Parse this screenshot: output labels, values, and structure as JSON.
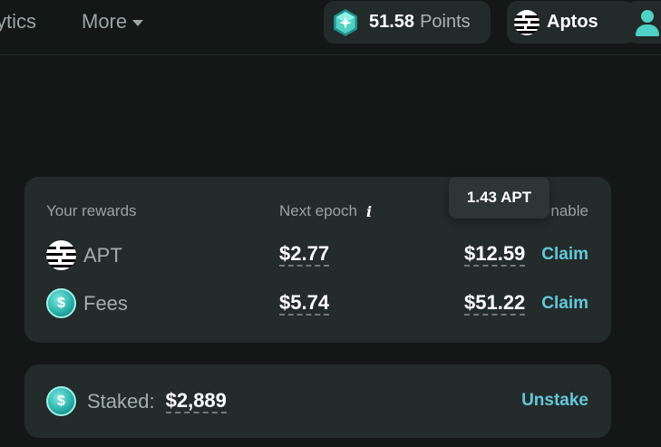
{
  "nav": {
    "analytics_label": "ytics",
    "more_label": "More",
    "points": {
      "value": "51.58",
      "label": "Points",
      "icon": "gem-icon"
    },
    "network": {
      "label": "Aptos",
      "icon": "aptos-logo-icon"
    },
    "user": {
      "icon": "user-icon"
    }
  },
  "rewards": {
    "headers": {
      "your_rewards": "Your rewards",
      "next_epoch": "Next epoch",
      "info": "i",
      "claimable_suffix": "nable"
    },
    "rows": [
      {
        "name": "APT",
        "next_epoch": "$2.77",
        "claimable": "$12.59",
        "action": "Claim",
        "icon": "aptos-logo-icon"
      },
      {
        "name": "Fees",
        "next_epoch": "$5.74",
        "claimable": "$51.22",
        "action": "Claim",
        "icon": "dollar-coin-icon"
      }
    ],
    "tooltip": "1.43 APT"
  },
  "staked": {
    "label": "Staked:",
    "value": "$2,889",
    "action": "Unstake",
    "icon": "dollar-coin-icon"
  },
  "colors": {
    "background": "#131817",
    "card": "#232b2b",
    "accent_link": "#64c7d8",
    "muted_text": "#98a3a2"
  }
}
